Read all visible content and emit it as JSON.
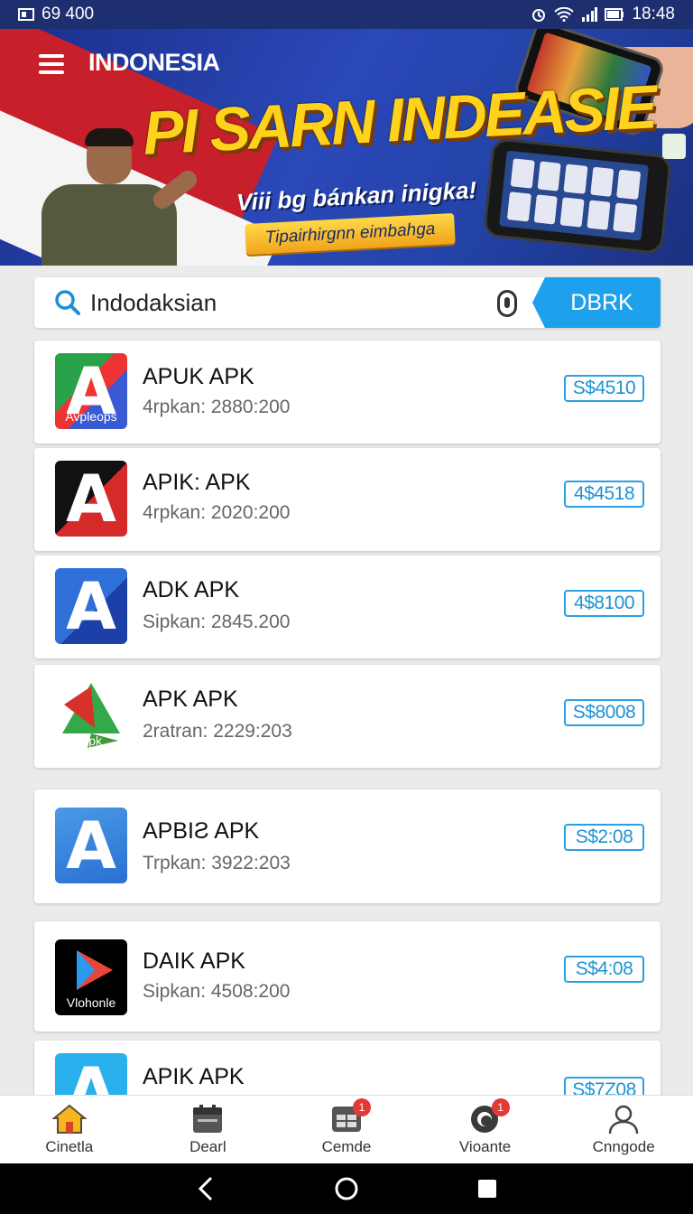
{
  "status_bar": {
    "left_text": "69 400",
    "time": "18:48"
  },
  "banner": {
    "brand": "INDONESIA",
    "headline": "PI SARN INDEASIE",
    "subline": "Viii bg bánkan inigka!",
    "cta_label": "Tipairhirgnn eimbahga"
  },
  "search": {
    "value": "Indodaksian",
    "button_label": "DBRK"
  },
  "apps": [
    {
      "title": "APUK APK",
      "meta": "4rpkan: 2880:200",
      "price": "S$4510",
      "icon_label": "Avpleops"
    },
    {
      "title": "APIK: APK",
      "meta": "4rpkan: 2020:200",
      "price": "4$4518"
    },
    {
      "title": "ADK APK",
      "meta": "Sipkan: 2845.200",
      "price": "4$8100"
    },
    {
      "title": "APK APK",
      "meta": "2ratran: 2229:203",
      "price": "S$8008",
      "icon_label": "Apk"
    },
    {
      "title": "APBIƧ APK",
      "meta": "Trpkan: 3922:203",
      "price": "S$2:08"
    },
    {
      "title": "DAIK APK",
      "meta": "Sipkan: 4508:200",
      "price": "S$4:08",
      "icon_label": "Vlohonle"
    },
    {
      "title": "APIK APK",
      "meta": "",
      "price": "S$7Z08"
    }
  ],
  "bottom_nav": [
    {
      "label": "Cinetla",
      "icon": "home-icon"
    },
    {
      "label": "Dearl",
      "icon": "calendar-icon"
    },
    {
      "label": "Cemde",
      "icon": "grid-icon",
      "badge": "1"
    },
    {
      "label": "Vioante",
      "icon": "record-icon",
      "badge": "1"
    },
    {
      "label": "Cnngode",
      "icon": "profile-icon"
    }
  ],
  "colors": {
    "accent": "#1ea0ec",
    "status_bar": "#1d2f6e",
    "headline": "#ffd21c",
    "badge": "#e53935"
  }
}
